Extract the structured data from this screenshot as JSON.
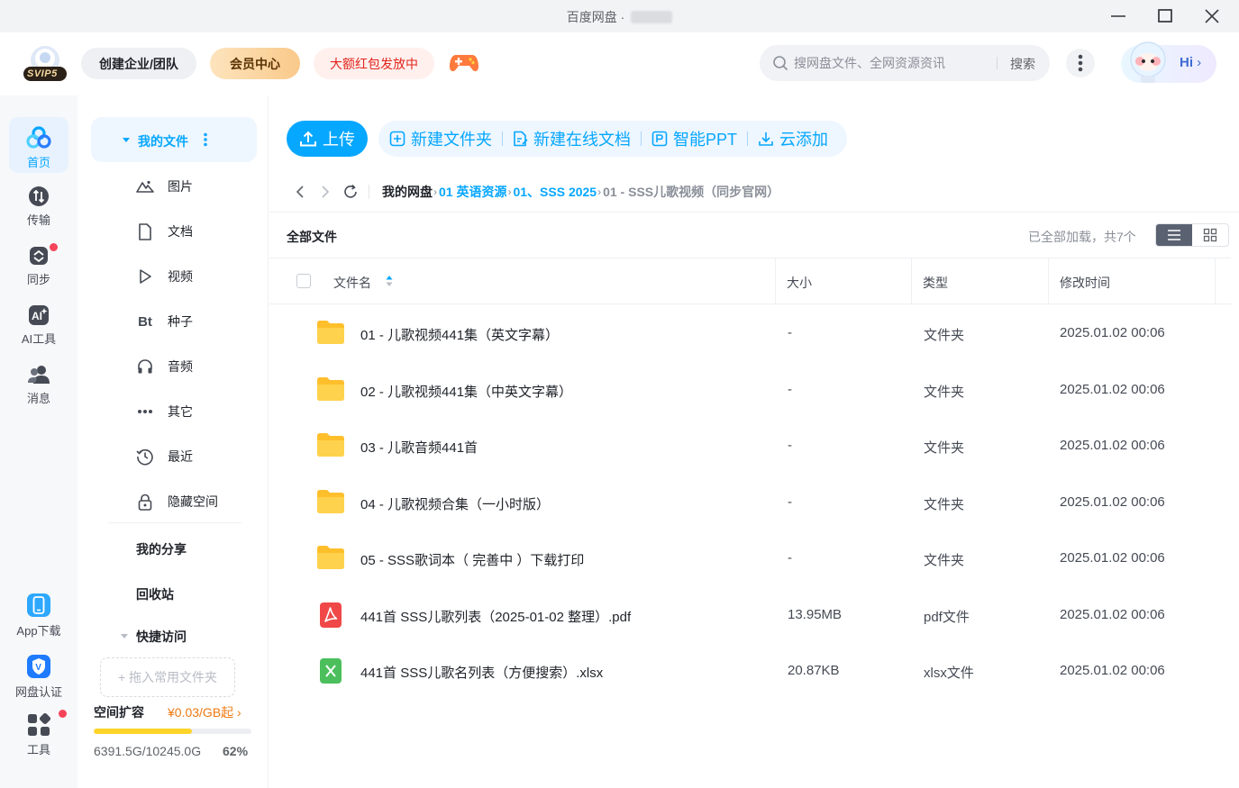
{
  "window": {
    "title": "百度网盘 · "
  },
  "header": {
    "logo_badge": "SVIP5",
    "enterprise_label": "创建企业/团队",
    "vip_label": "会员中心",
    "promo_label": "大额红包发放中",
    "search_placeholder": "搜网盘文件、全网资源资讯",
    "search_button": "搜索",
    "hi_label": "Hi"
  },
  "rail": {
    "items": [
      {
        "label": "首页",
        "icon": "home-icon"
      },
      {
        "label": "传输",
        "icon": "transfer-icon"
      },
      {
        "label": "同步",
        "icon": "sync-icon"
      },
      {
        "label": "AI工具",
        "icon": "ai-tools-icon"
      },
      {
        "label": "消息",
        "icon": "message-icon"
      }
    ],
    "bottom_items": [
      {
        "label": "App下载",
        "icon": "app-download-icon"
      },
      {
        "label": "网盘认证",
        "icon": "verify-icon"
      },
      {
        "label": "工具",
        "icon": "tools-icon"
      }
    ]
  },
  "sidebar": {
    "my_files": "我的文件",
    "categories": [
      {
        "label": "图片",
        "icon": "image-icon"
      },
      {
        "label": "文档",
        "icon": "document-icon"
      },
      {
        "label": "视频",
        "icon": "video-icon"
      },
      {
        "label": "种子",
        "icon": "torrent-icon",
        "glyph": "Bt"
      },
      {
        "label": "音频",
        "icon": "audio-icon"
      },
      {
        "label": "其它",
        "icon": "other-icon"
      },
      {
        "label": "最近",
        "icon": "recent-icon"
      },
      {
        "label": "隐藏空间",
        "icon": "lock-icon"
      }
    ],
    "my_share": "我的分享",
    "recycle_bin": "回收站",
    "quick_access": "快捷访问",
    "drop_hint": "+ 拖入常用文件夹",
    "space_title": "空间扩容",
    "space_price": "¥0.03/GB起",
    "space_usage": "6391.5G/10245.0G",
    "space_percent": "62%",
    "space_fraction": 0.62
  },
  "toolbar": {
    "upload": "上传",
    "new_folder": "新建文件夹",
    "new_online_doc": "新建在线文档",
    "smart_ppt": "智能PPT",
    "cloud_add": "云添加"
  },
  "breadcrumb": {
    "root": "我的网盘",
    "level1": "01 英语资源",
    "level2": "01、SSS 2025",
    "current": "01 - SSS儿歌视频（同步官网）"
  },
  "list": {
    "title": "全部文件",
    "loaded_status": "已全部加载，共7个",
    "columns": {
      "name": "文件名",
      "size": "大小",
      "type": "类型",
      "mtime": "修改时间"
    },
    "rows": [
      {
        "name": "01 - 儿歌视频441集（英文字幕）",
        "size": "-",
        "type": "文件夹",
        "mtime": "2025.01.02 00:06",
        "icon": "folder-icon"
      },
      {
        "name": "02 - 儿歌视频441集（中英文字幕）",
        "size": "-",
        "type": "文件夹",
        "mtime": "2025.01.02 00:06",
        "icon": "folder-icon"
      },
      {
        "name": "03 - 儿歌音频441首",
        "size": "-",
        "type": "文件夹",
        "mtime": "2025.01.02 00:06",
        "icon": "folder-icon"
      },
      {
        "name": "04 - 儿歌视频合集（一小时版）",
        "size": "-",
        "type": "文件夹",
        "mtime": "2025.01.02 00:06",
        "icon": "folder-icon"
      },
      {
        "name": "05 - SSS歌词本（ 完善中 ）下载打印",
        "size": "-",
        "type": "文件夹",
        "mtime": "2025.01.02 00:06",
        "icon": "folder-icon"
      },
      {
        "name": "441首 SSS儿歌列表（2025-01-02 整理）.pdf",
        "size": "13.95MB",
        "type": "pdf文件",
        "mtime": "2025.01.02 00:06",
        "icon": "pdf-icon"
      },
      {
        "name": "441首 SSS儿歌名列表（方便搜索）.xlsx",
        "size": "20.87KB",
        "type": "xlsx文件",
        "mtime": "2025.01.02 00:06",
        "icon": "xlsx-icon"
      }
    ]
  },
  "colors": {
    "accent": "#06a7ff",
    "folder": "#ffc83d",
    "pdf": "#f04848",
    "xlsx": "#4cbf5c",
    "badge_dot": "#f5445a",
    "progress": "#ffd42a"
  }
}
